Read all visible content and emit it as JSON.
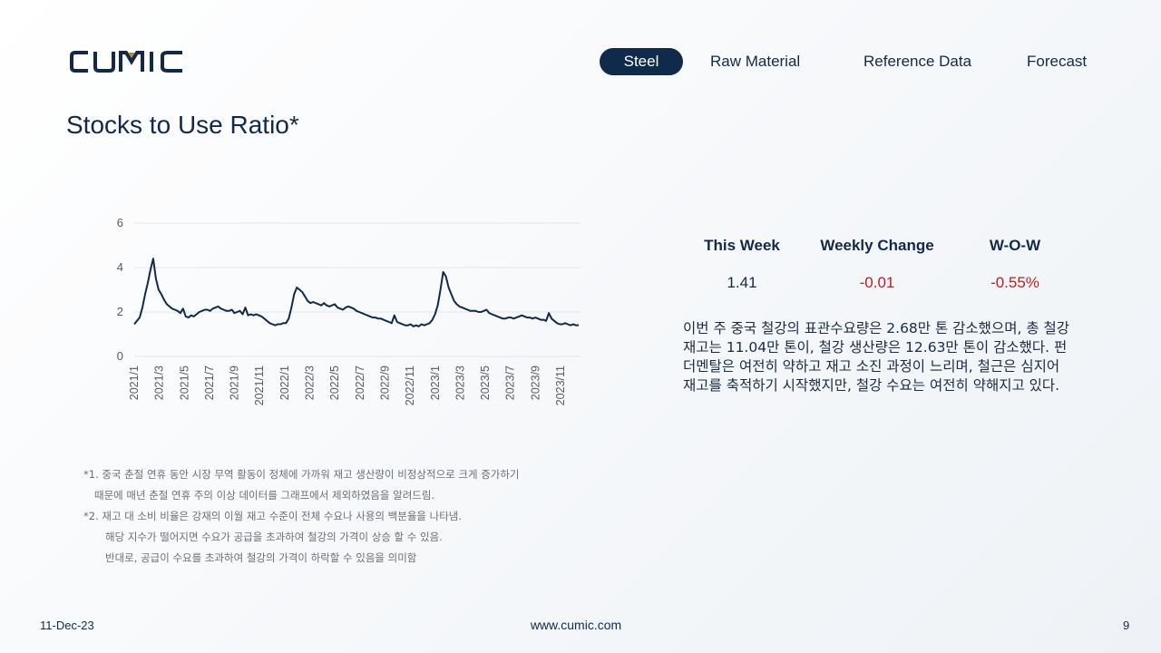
{
  "brand": {
    "logo_text": "CUMIC",
    "colors": {
      "navy": "#13294b",
      "accent_gold": "#b48a3c",
      "negative": "#c0201d"
    }
  },
  "nav": {
    "items": [
      {
        "label": "Steel",
        "active": true
      },
      {
        "label": "Raw Material",
        "active": false
      },
      {
        "label": "Reference Data",
        "active": false
      },
      {
        "label": "Forecast",
        "active": false
      }
    ]
  },
  "page": {
    "title": "Stocks to Use Ratio*"
  },
  "chart_data": {
    "type": "line",
    "ylim": [
      0,
      6
    ],
    "yticks": [
      "0",
      "2",
      "4",
      "6"
    ],
    "xtick_labels": [
      "2021/1",
      "2021/3",
      "2021/5",
      "2021/7",
      "2021/9",
      "2021/11",
      "2022/1",
      "2022/3",
      "2022/5",
      "2022/7",
      "2022/9",
      "2022/11",
      "2023/1",
      "2023/3",
      "2023/5",
      "2023/7",
      "2023/9",
      "2023/11"
    ],
    "grid": true,
    "series": [
      {
        "color": "#13294b",
        "values": [
          1.45,
          1.6,
          1.75,
          2.2,
          2.8,
          3.3,
          3.9,
          4.4,
          3.5,
          3.0,
          2.8,
          2.55,
          2.35,
          2.25,
          2.15,
          2.1,
          2.05,
          1.95,
          2.15,
          1.8,
          1.75,
          1.85,
          1.8,
          1.9,
          2.0,
          2.05,
          2.1,
          2.1,
          2.05,
          2.15,
          2.2,
          2.25,
          2.15,
          2.1,
          2.05,
          2.05,
          2.1,
          1.95,
          2.0,
          2.05,
          1.9,
          2.2,
          1.85,
          1.9,
          1.85,
          1.9,
          1.85,
          1.8,
          1.7,
          1.6,
          1.5,
          1.45,
          1.4,
          1.45,
          1.45,
          1.5,
          1.5,
          1.7,
          2.2,
          2.8,
          3.1,
          3.0,
          2.9,
          2.7,
          2.5,
          2.4,
          2.45,
          2.4,
          2.35,
          2.3,
          2.4,
          2.3,
          2.25,
          2.3,
          2.35,
          2.2,
          2.15,
          2.1,
          2.2,
          2.25,
          2.2,
          2.15,
          2.05,
          2.0,
          1.95,
          1.9,
          1.85,
          1.8,
          1.75,
          1.75,
          1.7,
          1.7,
          1.65,
          1.6,
          1.55,
          1.5,
          1.85,
          1.55,
          1.5,
          1.45,
          1.4,
          1.4,
          1.45,
          1.35,
          1.4,
          1.35,
          1.45,
          1.4,
          1.45,
          1.5,
          1.65,
          1.9,
          2.3,
          3.0,
          3.8,
          3.6,
          3.1,
          2.8,
          2.5,
          2.35,
          2.25,
          2.2,
          2.15,
          2.1,
          2.05,
          2.05,
          2.05,
          2.0,
          2.0,
          2.05,
          2.1,
          1.95,
          1.9,
          1.85,
          1.8,
          1.75,
          1.7,
          1.7,
          1.75,
          1.75,
          1.7,
          1.75,
          1.8,
          1.85,
          1.8,
          1.75,
          1.75,
          1.7,
          1.75,
          1.7,
          1.65,
          1.65,
          1.6,
          1.95,
          1.7,
          1.6,
          1.5,
          1.45,
          1.45,
          1.5,
          1.45,
          1.4,
          1.45,
          1.4,
          1.41
        ]
      }
    ]
  },
  "stats": {
    "headers": [
      "This Week",
      "Weekly Change",
      "W-O-W"
    ],
    "values": [
      "1.41",
      "-0.01",
      "-0.55%"
    ]
  },
  "commentary": "이번 주 중국 철강의 표관수요량은 2.68만 톤 감소했으며, 총 철강 재고는 11.04만 톤이, 철강 생산량은 12.63만 톤이 감소했다. 펀더멘탈은 여전히 약하고 재고 소진 과정이 느리며, 철근은 심지어 재고를 축적하기 시작했지만, 철강 수요는 여전히 약해지고 있다.",
  "footnotes": [
    "*1. 중국 춘절 연휴 동안 시장 무역 활동이 정체에 가까워 재고 생산량이 비정상적으로 크게 증가하기",
    "때문에 매년 춘절 연휴 주의 이상 데이터를 그래프에서 제외하였음을 알려드림.",
    "*2.  재고 대 소비 비율은 강재의 이월 재고 수준이 전체 수요나 사용의 백분율을 나타냄.",
    "해당 지수가 떨어지면 수요가 공급을 초과하여 철강의 가격이 상승 할 수 있음.",
    "반대로, 공급이 수요를 초과하여 철강의 가격이 하락할 수 있음을 의미함"
  ],
  "footer": {
    "date": "11-Dec-23",
    "url": "www.cumic.com",
    "page_number": "9"
  }
}
